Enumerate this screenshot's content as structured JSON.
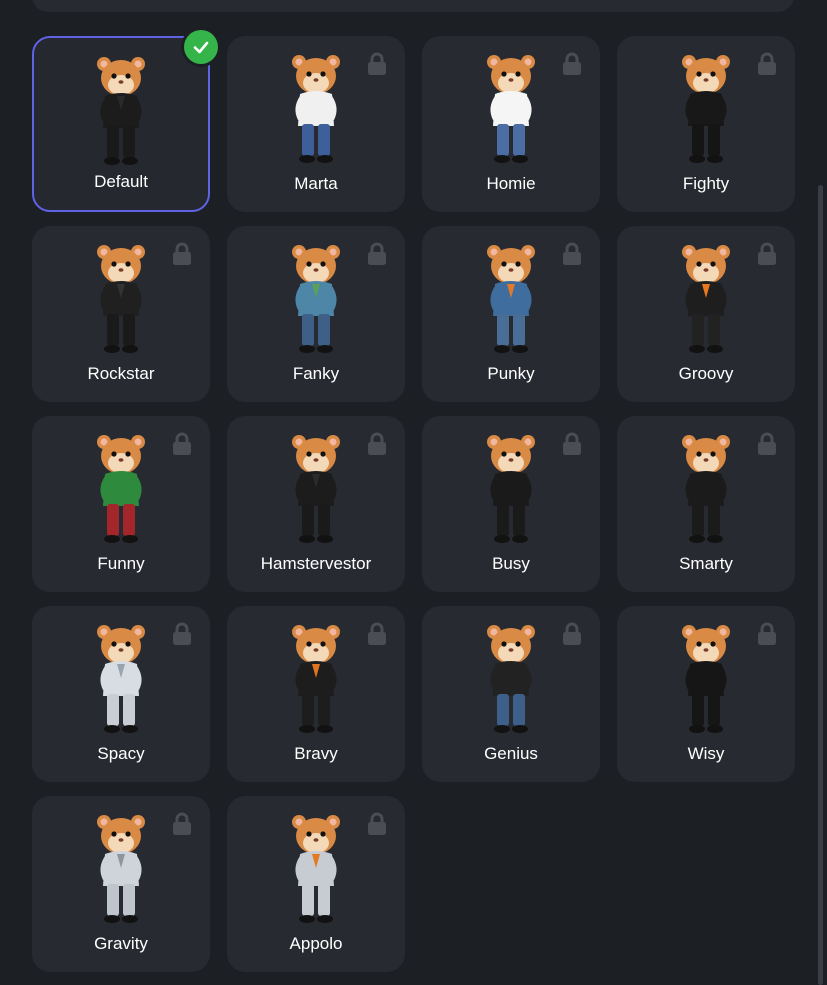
{
  "skins": [
    {
      "label": "Default",
      "selected": true,
      "locked": false,
      "outfit": "black suit",
      "outfit_color": "#1c1c1c",
      "accent_color": "#2a2a2a",
      "pants_color": "#1a1a1a"
    },
    {
      "label": "Marta",
      "selected": false,
      "locked": true,
      "outfit": "white top and jeans",
      "outfit_color": "#f0f0f0",
      "accent_color": "#f0f0f0",
      "pants_color": "#3d5f9a"
    },
    {
      "label": "Homie",
      "selected": false,
      "locked": true,
      "outfit": "white t-shirt and jeans",
      "outfit_color": "#f5f5f5",
      "accent_color": "#f5f5f5",
      "pants_color": "#4a6da3"
    },
    {
      "label": "Fighty",
      "selected": false,
      "locked": true,
      "outfit": "black outfit",
      "outfit_color": "#181818",
      "accent_color": "#181818",
      "pants_color": "#151515"
    },
    {
      "label": "Rockstar",
      "selected": false,
      "locked": true,
      "outfit": "black leather",
      "outfit_color": "#202020",
      "accent_color": "#333333",
      "pants_color": "#1a1a1a"
    },
    {
      "label": "Fanky",
      "selected": false,
      "locked": true,
      "outfit": "green shirt and denim",
      "outfit_color": "#4e86a8",
      "accent_color": "#5aa05a",
      "pants_color": "#3e5f86"
    },
    {
      "label": "Punky",
      "selected": false,
      "locked": true,
      "outfit": "denim jacket",
      "outfit_color": "#3f6d9e",
      "accent_color": "#e07a2a",
      "pants_color": "#4a6d98"
    },
    {
      "label": "Groovy",
      "selected": false,
      "locked": true,
      "outfit": "black and orange",
      "outfit_color": "#1e1e1e",
      "accent_color": "#e8771f",
      "pants_color": "#222222"
    },
    {
      "label": "Funny",
      "selected": false,
      "locked": true,
      "outfit": "green jacket red pants",
      "outfit_color": "#2e8a3c",
      "accent_color": "#2e8a3c",
      "pants_color": "#a3262a"
    },
    {
      "label": "Hamstervestor",
      "selected": false,
      "locked": true,
      "outfit": "black suit",
      "outfit_color": "#1c1c1c",
      "accent_color": "#2b2b2b",
      "pants_color": "#1a1a1a"
    },
    {
      "label": "Busy",
      "selected": false,
      "locked": true,
      "outfit": "black dress",
      "outfit_color": "#1a1a1a",
      "accent_color": "#1a1a1a",
      "pants_color": "#1a1a1a"
    },
    {
      "label": "Smarty",
      "selected": false,
      "locked": true,
      "outfit": "black outfit",
      "outfit_color": "#1b1b1b",
      "accent_color": "#1b1b1b",
      "pants_color": "#1b1b1b"
    },
    {
      "label": "Spacy",
      "selected": false,
      "locked": true,
      "outfit": "astronaut suit",
      "outfit_color": "#d8dde3",
      "accent_color": "#9aa4ae",
      "pants_color": "#c9ced4"
    },
    {
      "label": "Bravy",
      "selected": false,
      "locked": true,
      "outfit": "black outfit",
      "outfit_color": "#1d1d1d",
      "accent_color": "#e0751f",
      "pants_color": "#1d1d1d"
    },
    {
      "label": "Genius",
      "selected": false,
      "locked": true,
      "outfit": "black top and jeans",
      "outfit_color": "#222222",
      "accent_color": "#222222",
      "pants_color": "#3d5f8a"
    },
    {
      "label": "Wisy",
      "selected": false,
      "locked": true,
      "outfit": "black coat",
      "outfit_color": "#161616",
      "accent_color": "#161616",
      "pants_color": "#161616"
    },
    {
      "label": "Gravity",
      "selected": false,
      "locked": true,
      "outfit": "silver space suit",
      "outfit_color": "#cfd4da",
      "accent_color": "#8d959e",
      "pants_color": "#bfc5cc"
    },
    {
      "label": "Appolo",
      "selected": false,
      "locked": true,
      "outfit": "orange and silver suit",
      "outfit_color": "#c6ccd2",
      "accent_color": "#e37a22",
      "pants_color": "#c6ccd2"
    }
  ],
  "colors": {
    "background": "#1c1f24",
    "card": "#272a30",
    "selected_border": "#5f63e6",
    "check_badge": "#35b549",
    "lock_icon": "#4a4d53",
    "fur": "#d98a45"
  }
}
